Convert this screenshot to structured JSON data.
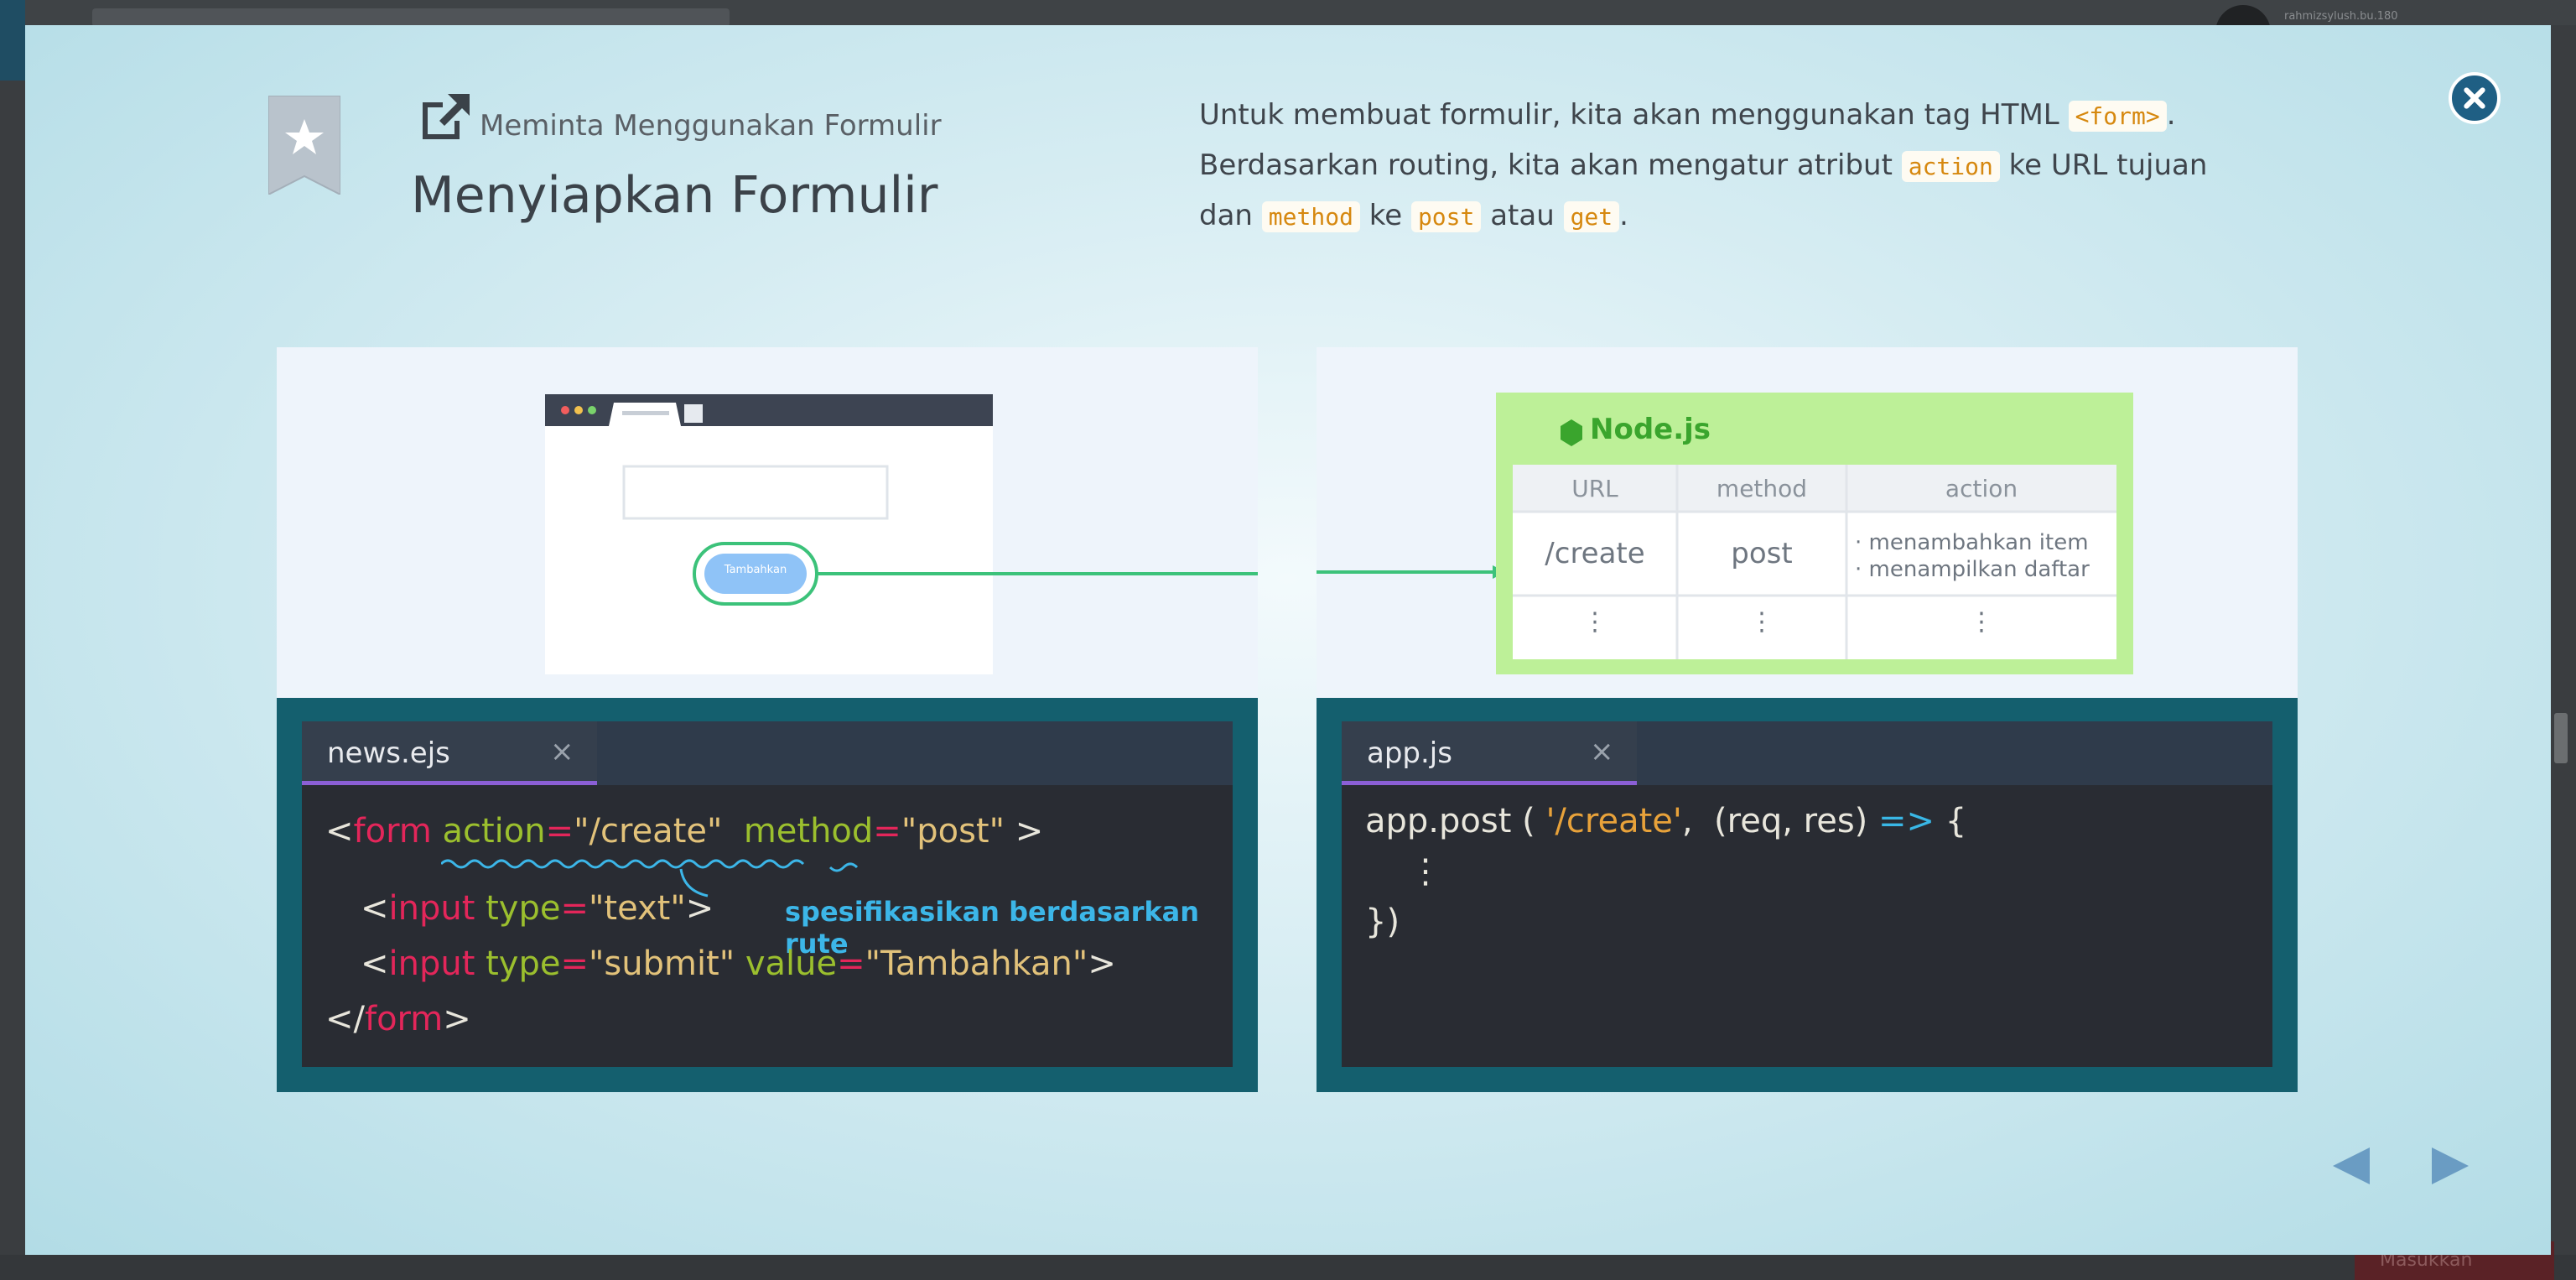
{
  "background": {
    "username": "rahmizsylush.bu.180",
    "bottom_button": "Masukkan"
  },
  "header": {
    "subtitle": "Meminta Menggunakan Formulir",
    "title": "Menyiapkan Formulir"
  },
  "description": {
    "line1_a": "Untuk membuat formulir, kita akan menggunakan tag HTML ",
    "tag_form": "<form>",
    "line1_b": ".",
    "line2_a": "Berdasarkan routing, kita akan mengatur atribut ",
    "tag_action": "action",
    "line2_b": " ke URL tujuan",
    "line3_a": "dan ",
    "tag_method": "method",
    "line3_b": " ke ",
    "tag_post": "post",
    "line3_c": " atau ",
    "tag_get": "get",
    "line3_d": "."
  },
  "left_panel": {
    "browser_button": "Tambahkan",
    "file_name": "news.ejs",
    "tab_close": "×",
    "code": {
      "l1_lt": "<",
      "l1_tag": "form",
      "l1_attr1": " action",
      "l1_eq1": "=",
      "l1_val1": "\"/create\"",
      "l1_attr2": "  method",
      "l1_eq2": "=",
      "l1_val2": "\"post\"",
      "l1_gt": " >",
      "l2_lt": "<",
      "l2_tag": "input",
      "l2_attr": " type",
      "l2_eq": "=",
      "l2_val": "\"text\"",
      "l2_gt": ">",
      "l3_lt": "<",
      "l3_tag": "input",
      "l3_attr1": " type",
      "l3_eq1": "=",
      "l3_val1": "\"submit\"",
      "l3_attr2": " value",
      "l3_eq2": "=",
      "l3_val2": "\"Tambahkan\"",
      "l3_gt": ">",
      "l4_lt": "</",
      "l4_tag": "form",
      "l4_gt": ">"
    },
    "annotation": "spesifikasikan berdasarkan rute"
  },
  "right_panel": {
    "node_title": "Node.js",
    "table": {
      "headers": [
        "URL",
        "method",
        "action"
      ],
      "row1": {
        "url": "/create",
        "method": "post",
        "action1": "· menambahkan item",
        "action2": "· menampilkan daftar"
      },
      "row2": {
        "url": "⋮",
        "method": "⋮",
        "action": "⋮"
      }
    },
    "file_name": "app.js",
    "tab_close": "×",
    "code": {
      "l1_a": "app.post ( ",
      "l1_str": "'/create'",
      "l1_b": ",  (req, res) ",
      "l1_arrow": "=>",
      "l1_c": " {",
      "l2": "⋮",
      "l3": "})"
    }
  },
  "colors": {
    "accent": "#1f5f84",
    "node_green": "#bdf098",
    "editor_bg": "#292c33"
  }
}
